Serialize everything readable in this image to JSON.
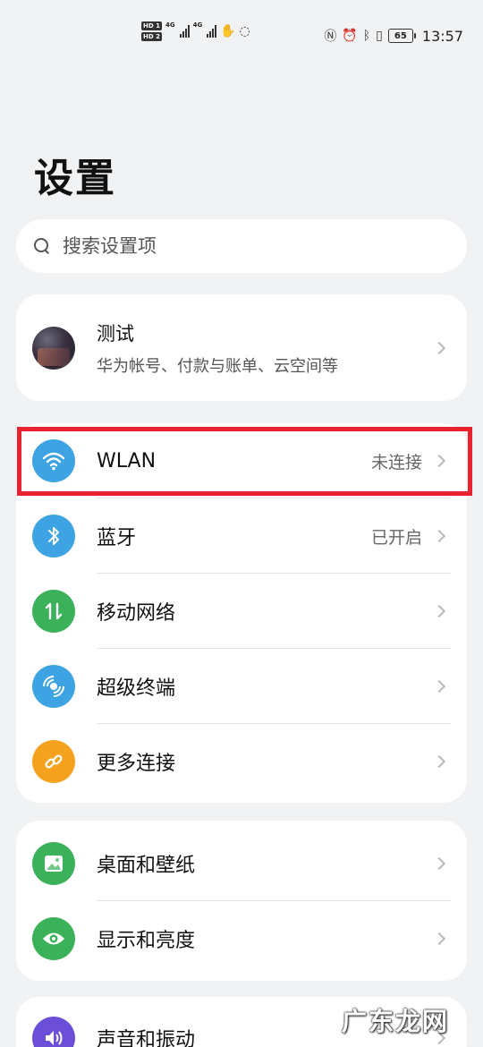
{
  "status_bar": {
    "hd1": "HD 1",
    "hd2": "HD 2",
    "net1": "4G",
    "net2": "4G",
    "battery": "65",
    "time": "13:57"
  },
  "page": {
    "title": "设置"
  },
  "search": {
    "placeholder": "搜索设置项"
  },
  "account": {
    "name": "测试",
    "subtitle": "华为帐号、付款与账单、云空间等"
  },
  "network_group": [
    {
      "label": "WLAN",
      "value": "未连接",
      "icon": "wifi-icon",
      "color": "#3ea3e3"
    },
    {
      "label": "蓝牙",
      "value": "已开启",
      "icon": "bluetooth-icon",
      "color": "#3ea3e3"
    },
    {
      "label": "移动网络",
      "value": "",
      "icon": "mobile-data-icon",
      "color": "#3bb15a"
    },
    {
      "label": "超级终端",
      "value": "",
      "icon": "super-device-icon",
      "color": "#3ea3e3"
    },
    {
      "label": "更多连接",
      "value": "",
      "icon": "link-icon",
      "color": "#f5a21e"
    }
  ],
  "display_group": [
    {
      "label": "桌面和壁纸",
      "icon": "wallpaper-icon",
      "color": "#3bb15a"
    },
    {
      "label": "显示和亮度",
      "icon": "eye-icon",
      "color": "#3bb15a"
    }
  ],
  "sound_group": [
    {
      "label": "声音和振动",
      "icon": "volume-icon",
      "color": "#6c4fd8"
    }
  ],
  "watermark": "广东龙网"
}
